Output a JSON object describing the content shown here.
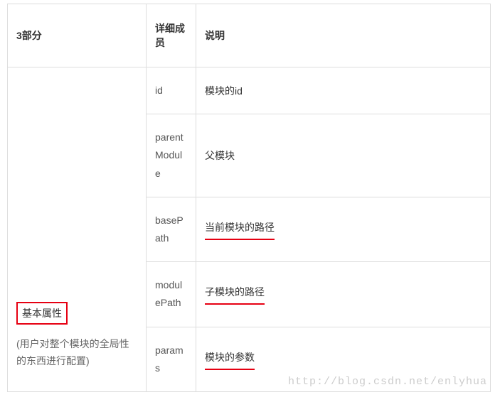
{
  "header": {
    "col1": "3部分",
    "col2": "详细成员",
    "col3": "说明"
  },
  "group": {
    "title": "基本属性",
    "subtitle": "(用户对整个模块的全局性的东西进行配置)"
  },
  "rows": [
    {
      "member": "id",
      "desc": "模块的id",
      "underline": false
    },
    {
      "member": "parentModule",
      "desc": "父模块",
      "underline": false
    },
    {
      "member": "basePath",
      "desc": "当前模块的路径",
      "underline": true
    },
    {
      "member": "modulePath",
      "desc": "子模块的路径",
      "underline": true
    },
    {
      "member": "params",
      "desc": "模块的参数",
      "underline": true
    }
  ],
  "watermark": "http://blog.csdn.net/enlyhua"
}
